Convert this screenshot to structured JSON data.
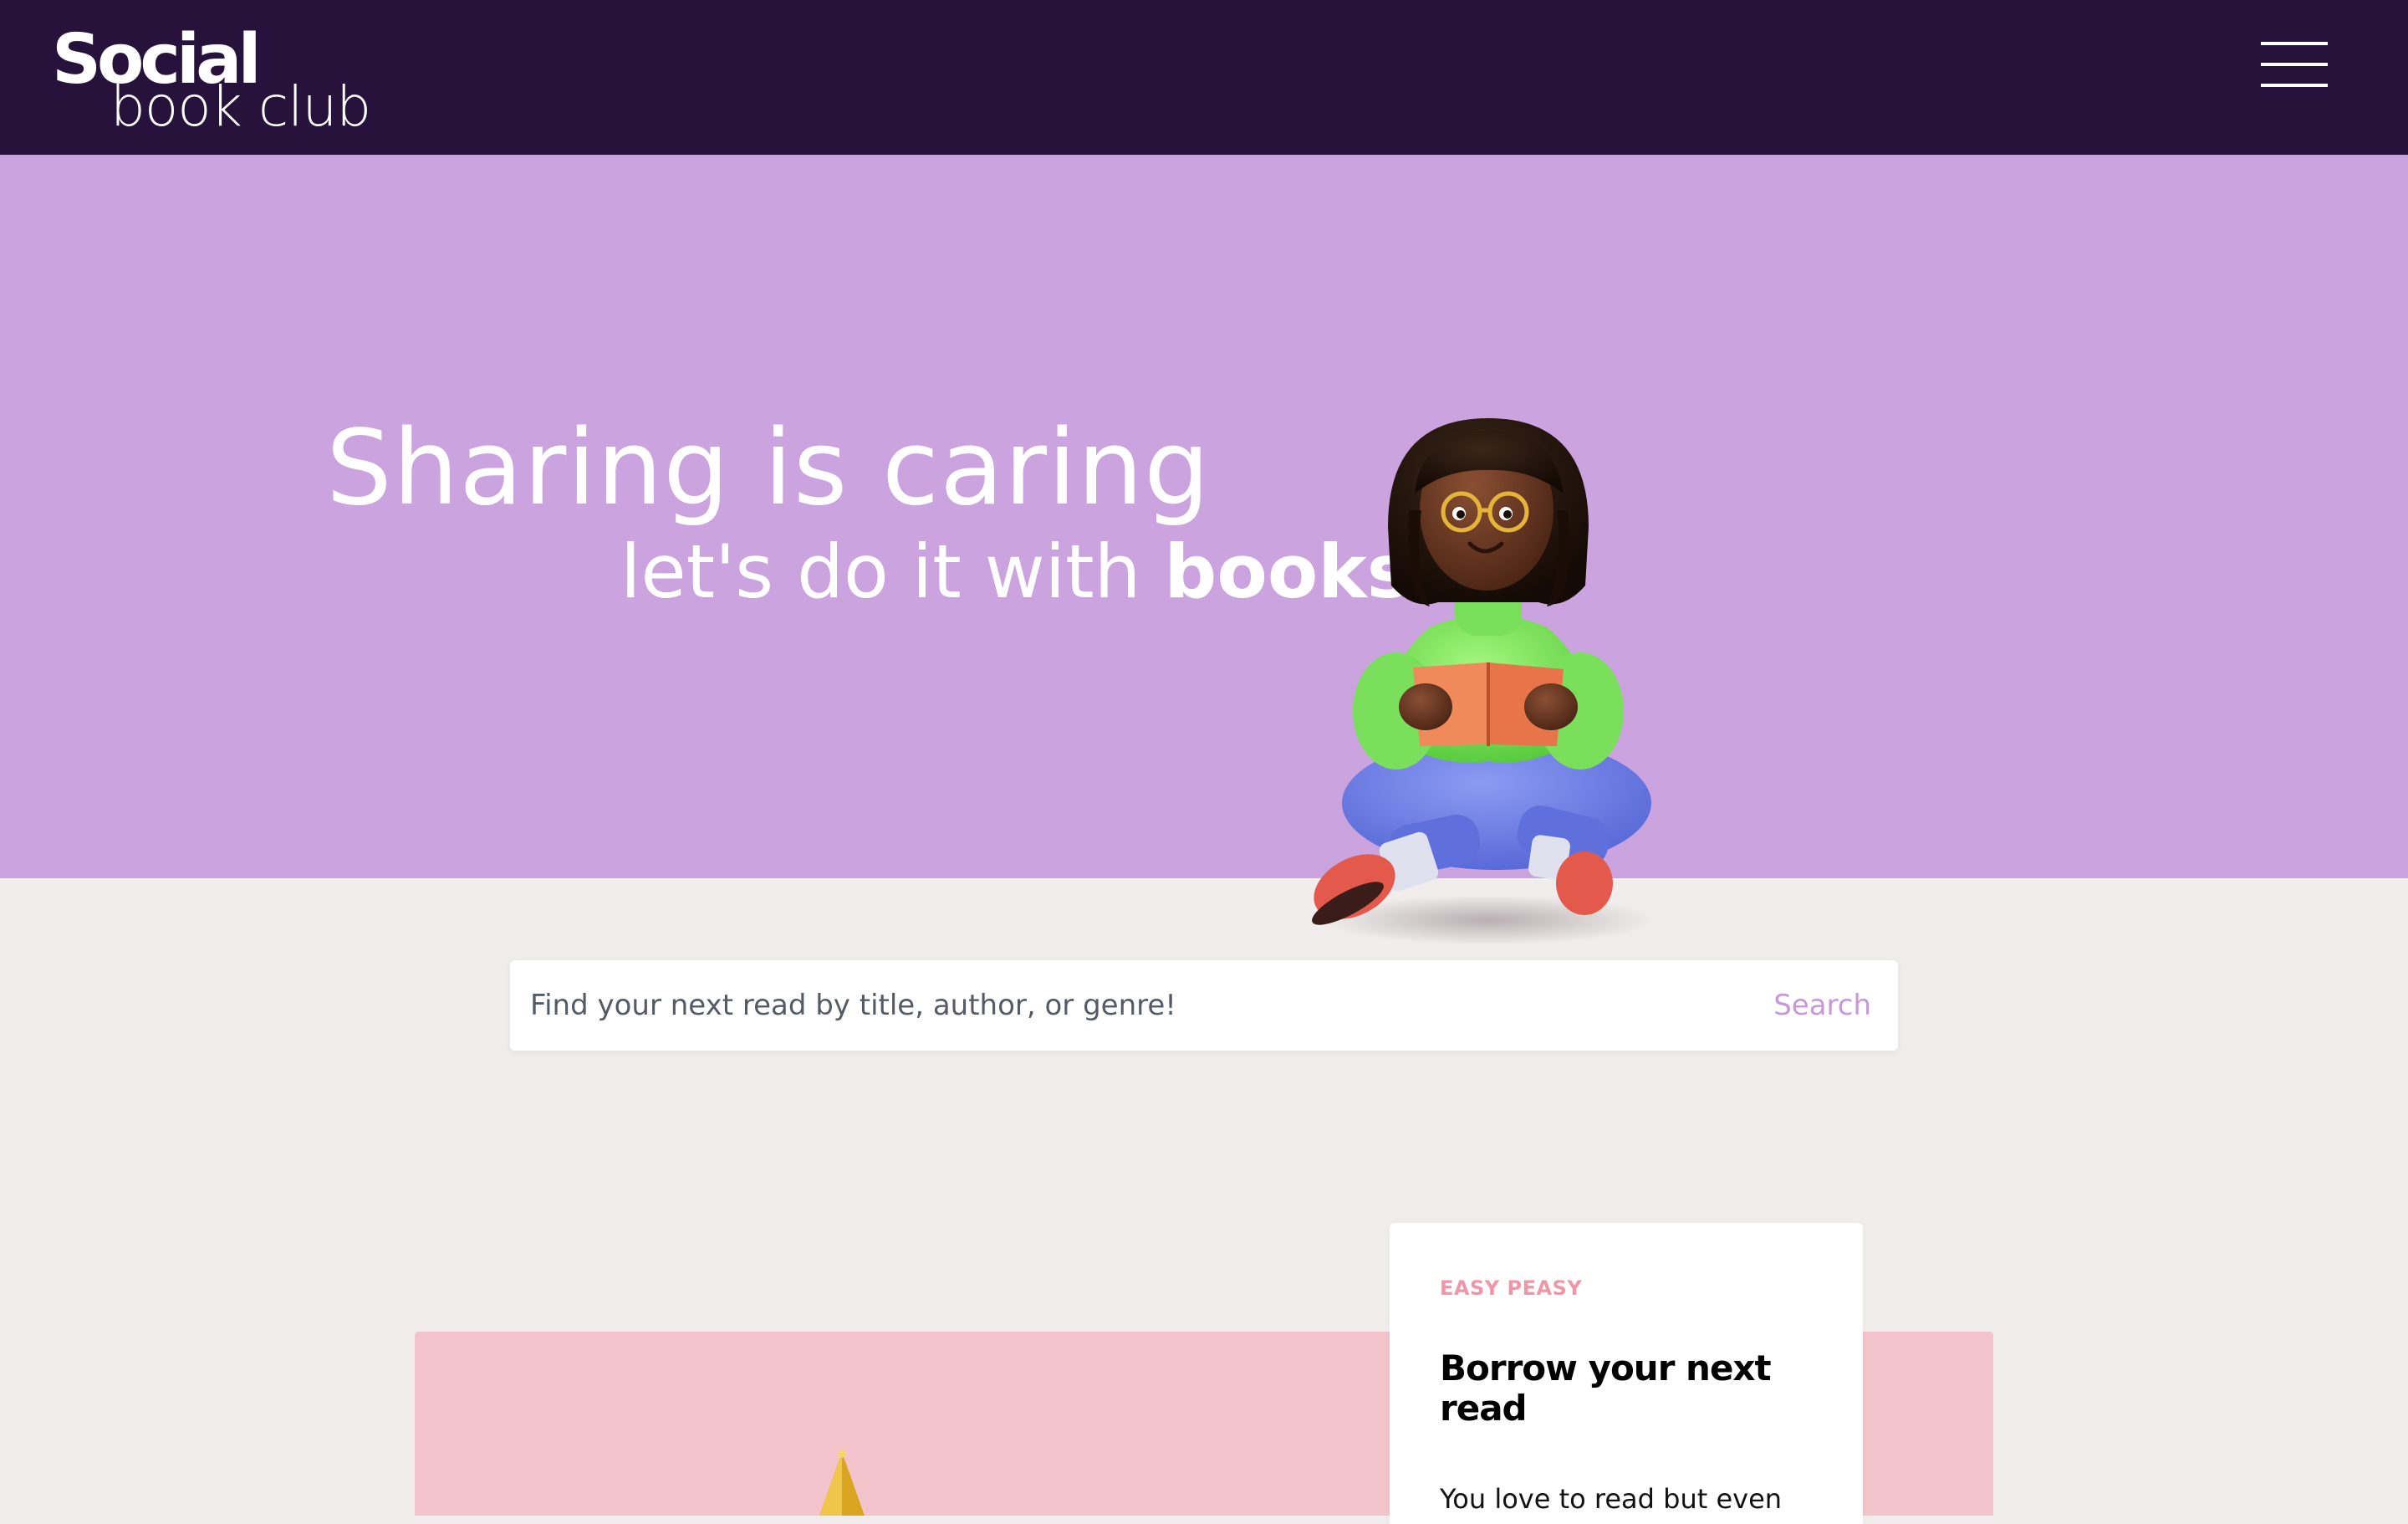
{
  "header": {
    "logo_top": "Social",
    "logo_bottom": "book club",
    "menu_icon": "hamburger-menu-icon"
  },
  "hero": {
    "title": "Sharing is caring",
    "subtitle_prefix": "let's do it with ",
    "subtitle_emphasis": "books!",
    "illustration": "girl-reading-book-illustration"
  },
  "search": {
    "placeholder": "Find your next read by title, author, or genre!",
    "button_label": "Search"
  },
  "feature": {
    "eyebrow": "EASY PEASY",
    "title": "Borrow your next read",
    "body": "You love to read but even",
    "image_icon": "gold-trophy-illustration"
  },
  "colors": {
    "header_bg": "#27123b",
    "hero_bg": "#cba4df",
    "page_bg": "#f0edec",
    "accent": "#c69ad9",
    "pink_band": "#f4c4cd",
    "eyebrow": "#ef97a8"
  }
}
